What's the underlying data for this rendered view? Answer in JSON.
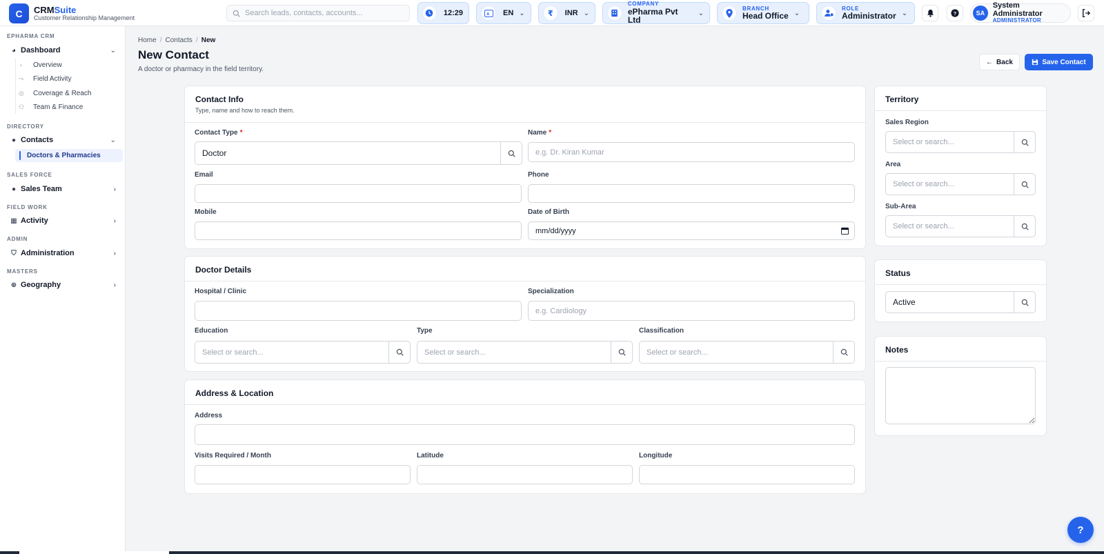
{
  "brand": {
    "name_main": "CRM",
    "name_accent": "Suite",
    "subtitle": "Customer Relationship Management",
    "logo_letter": "C"
  },
  "search": {
    "placeholder": "Search leads, contacts, accounts..."
  },
  "header": {
    "time": "12:29",
    "language": "EN",
    "currency": "INR",
    "currency_symbol": "₹",
    "company_label": "COMPANY",
    "company": "ePharma Pvt Ltd",
    "branch_label": "BRANCH",
    "branch": "Head Office",
    "role_label": "ROLE",
    "role": "Administrator",
    "user_initials": "SA",
    "user_name": "System Administrator",
    "user_role": "ADMINISTRATOR"
  },
  "sidebar": {
    "sections": [
      {
        "title": "EPHARMA CRM"
      },
      {
        "title": "DIRECTORY"
      },
      {
        "title": "SALES FORCE"
      },
      {
        "title": "FIELD WORK"
      },
      {
        "title": "ADMIN"
      },
      {
        "title": "MASTERS"
      }
    ],
    "dashboard": "Dashboard",
    "dashboard_items": [
      "Overview",
      "Field Activity",
      "Coverage & Reach",
      "Team & Finance"
    ],
    "contacts": "Contacts",
    "contacts_items": [
      "Doctors & Pharmacies"
    ],
    "sales_team": "Sales Team",
    "activity": "Activity",
    "administration": "Administration",
    "geography": "Geography"
  },
  "breadcrumb": [
    "Home",
    "Contacts",
    "New"
  ],
  "page": {
    "title": "New Contact",
    "subtitle": "A doctor or pharmacy in the field territory.",
    "back": "Back",
    "save": "Save Contact"
  },
  "contact_info": {
    "title": "Contact Info",
    "subtitle": "Type, name and how to reach them.",
    "contact_type_label": "Contact Type",
    "contact_type_value": "Doctor",
    "name_label": "Name",
    "name_placeholder": "e.g. Dr. Kiran Kumar",
    "email_label": "Email",
    "phone_label": "Phone",
    "mobile_label": "Mobile",
    "dob_label": "Date of Birth",
    "dob_placeholder": "mm/dd/yyyy"
  },
  "doctor_details": {
    "title": "Doctor Details",
    "hospital_label": "Hospital / Clinic",
    "specialization_label": "Specialization",
    "specialization_placeholder": "e.g. Cardiology",
    "education_label": "Education",
    "type_label": "Type",
    "classification_label": "Classification",
    "select_placeholder": "Select or search..."
  },
  "address": {
    "title": "Address & Location",
    "address_label": "Address",
    "visits_label": "Visits Required / Month",
    "latitude_label": "Latitude",
    "longitude_label": "Longitude"
  },
  "territory": {
    "title": "Territory",
    "region_label": "Sales Region",
    "area_label": "Area",
    "subarea_label": "Sub-Area",
    "select_placeholder": "Select or search..."
  },
  "status": {
    "title": "Status",
    "value": "Active"
  },
  "notes": {
    "title": "Notes"
  },
  "help": "?",
  "colors": {
    "accent": "#2563eb",
    "required": "#dc2626"
  }
}
